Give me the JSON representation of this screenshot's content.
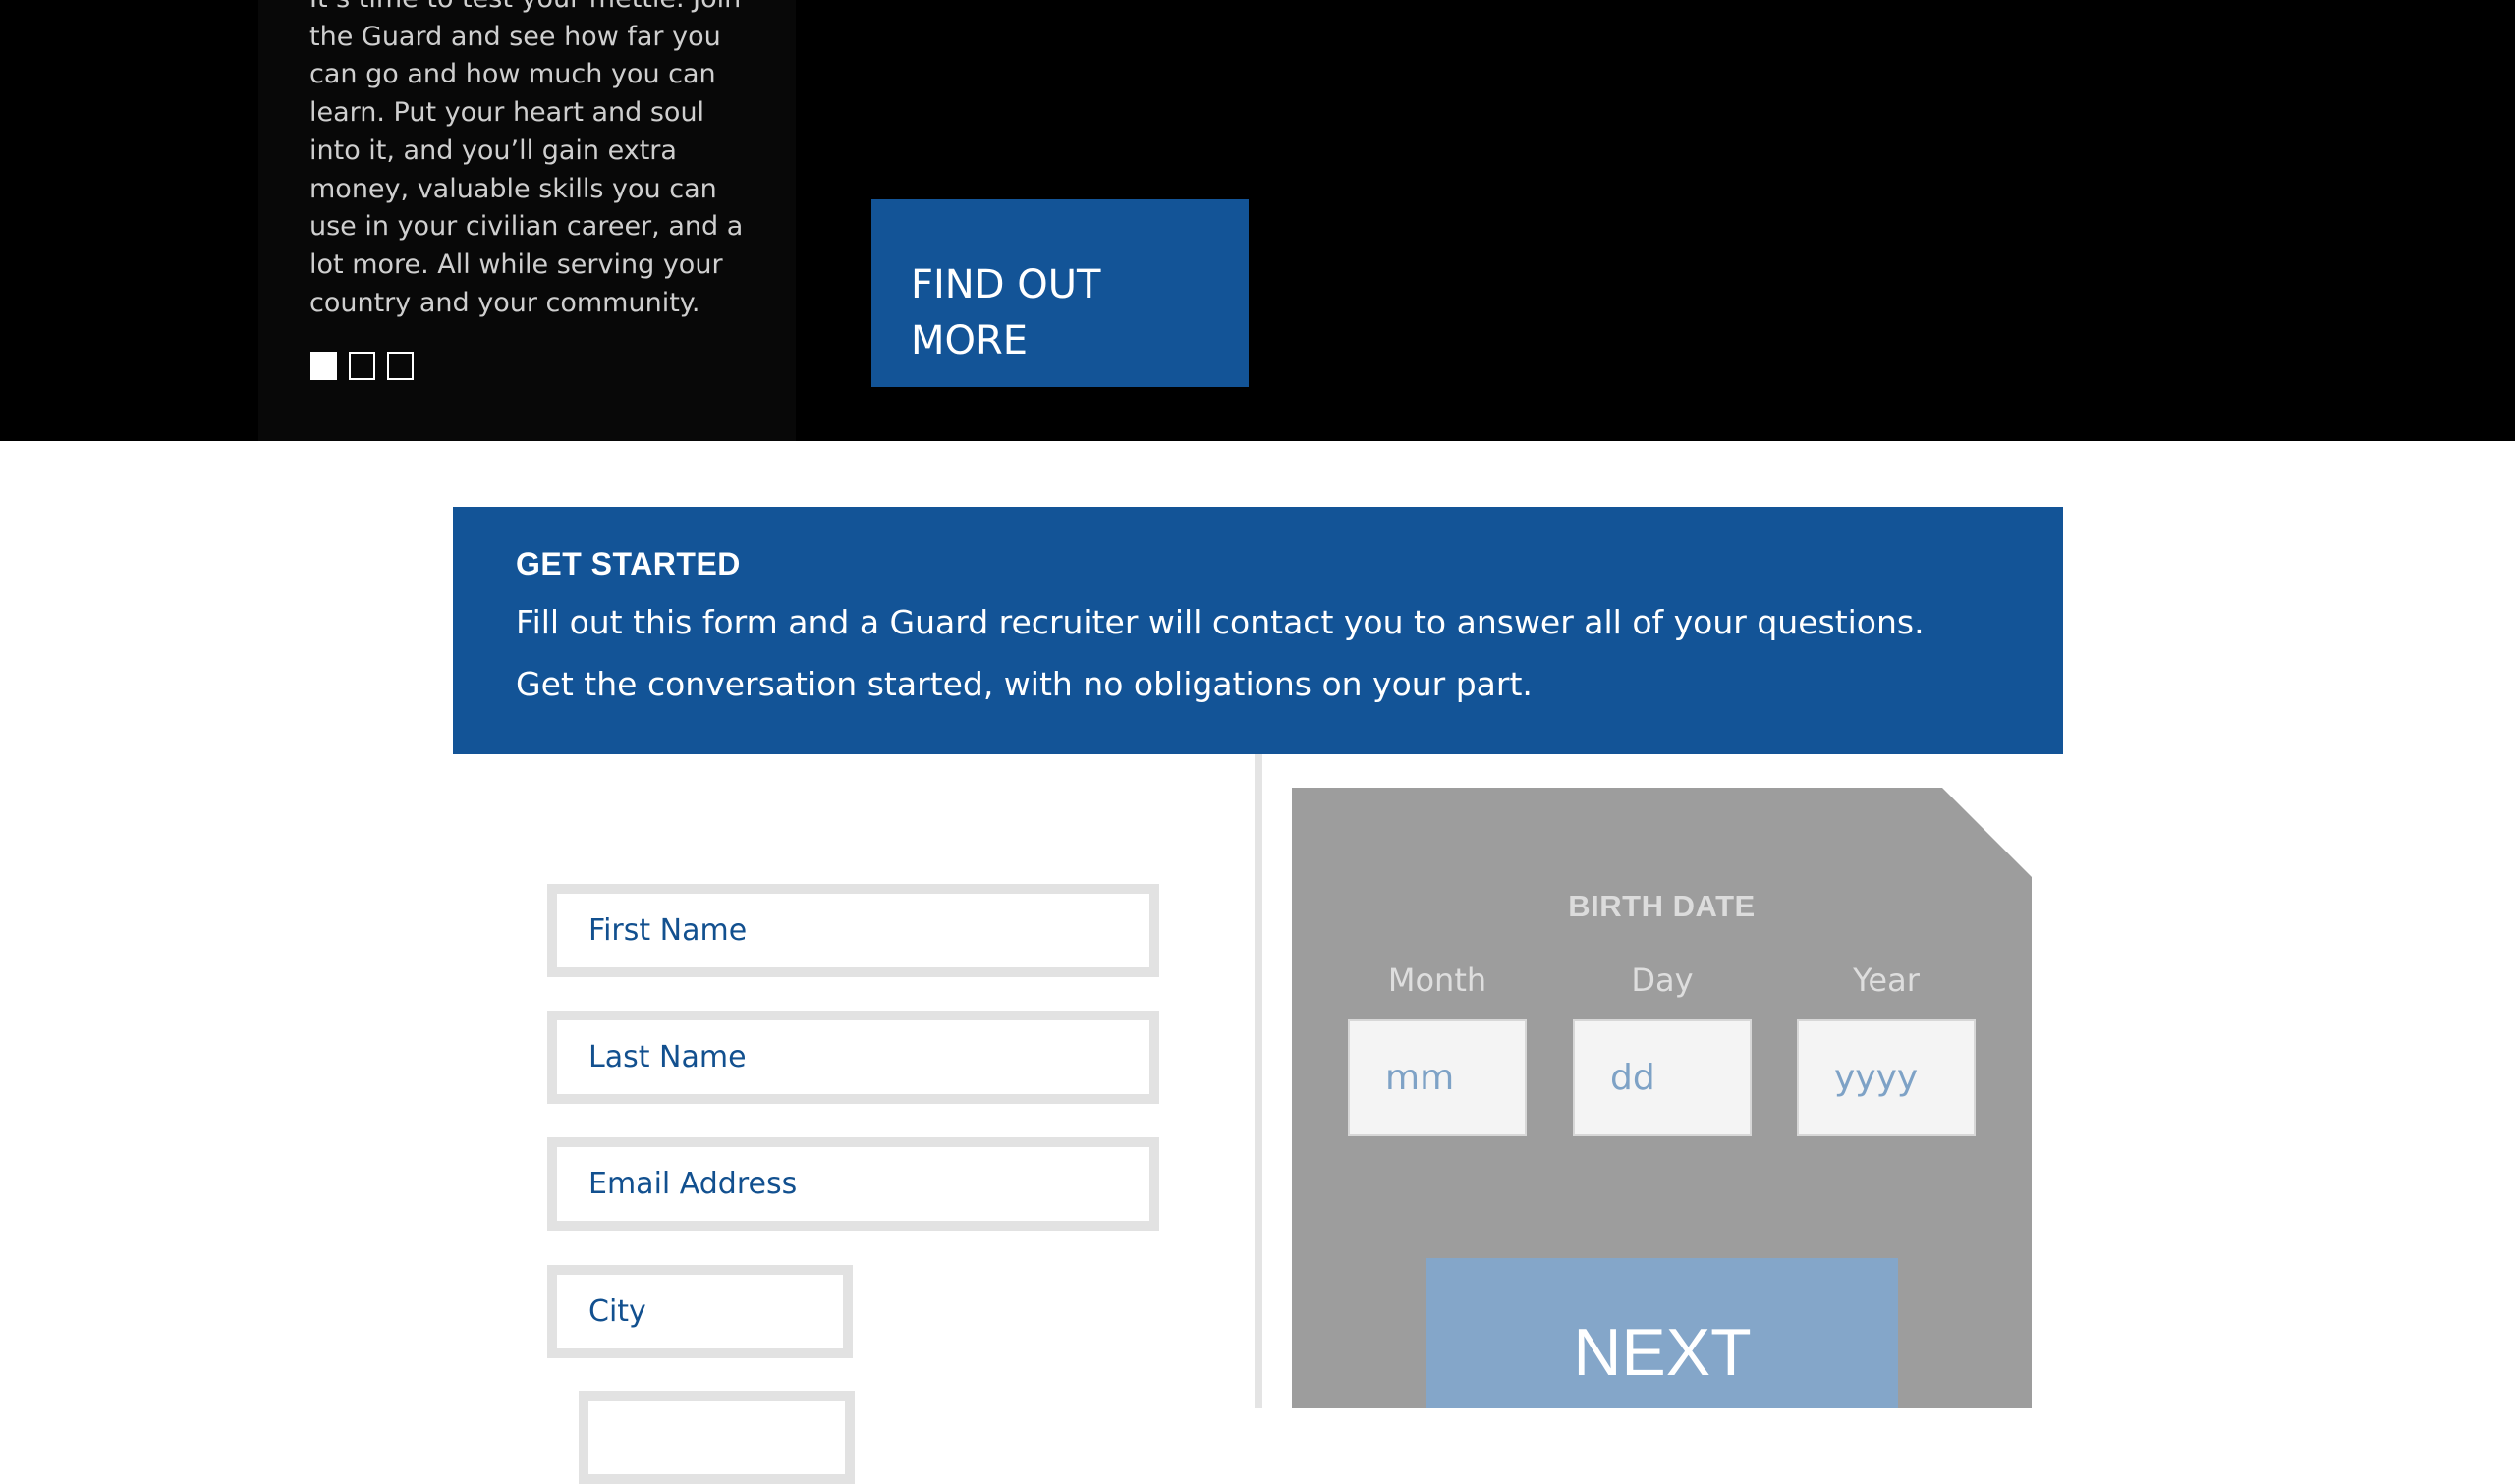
{
  "hero": {
    "body_text": "It’s time to test your mettle. Join the Guard and see how far you can go and how much you can learn. Put your heart and soul into it, and you’ll gain extra money, valuable skills you can use in your civilian career, and a lot more. All while serving your country and your community.",
    "carousel": {
      "slide_count": 3,
      "active_index": 0
    },
    "cta_label": "FIND OUT MORE"
  },
  "banner": {
    "title": "GET STARTED",
    "line1": "Fill out this form and a Guard recruiter will contact you to answer all of your questions.",
    "line2": "Get the conversation started, with no obligations on your part."
  },
  "form": {
    "first_name_placeholder": "First Name",
    "last_name_placeholder": "Last Name",
    "email_placeholder": "Email Address",
    "city_placeholder": "City",
    "next_field_placeholder": ""
  },
  "birth_date": {
    "title": "BIRTH DATE",
    "month_label": "Month",
    "day_label": "Day",
    "year_label": "Year",
    "month_placeholder": "mm",
    "day_placeholder": "dd",
    "year_placeholder": "yyyy",
    "next_label": "NEXT"
  },
  "colors": {
    "brand_blue": "#135497",
    "next_button": "#84a6c9",
    "panel_gray": "#9d9d9d",
    "field_text": "#12508f"
  }
}
